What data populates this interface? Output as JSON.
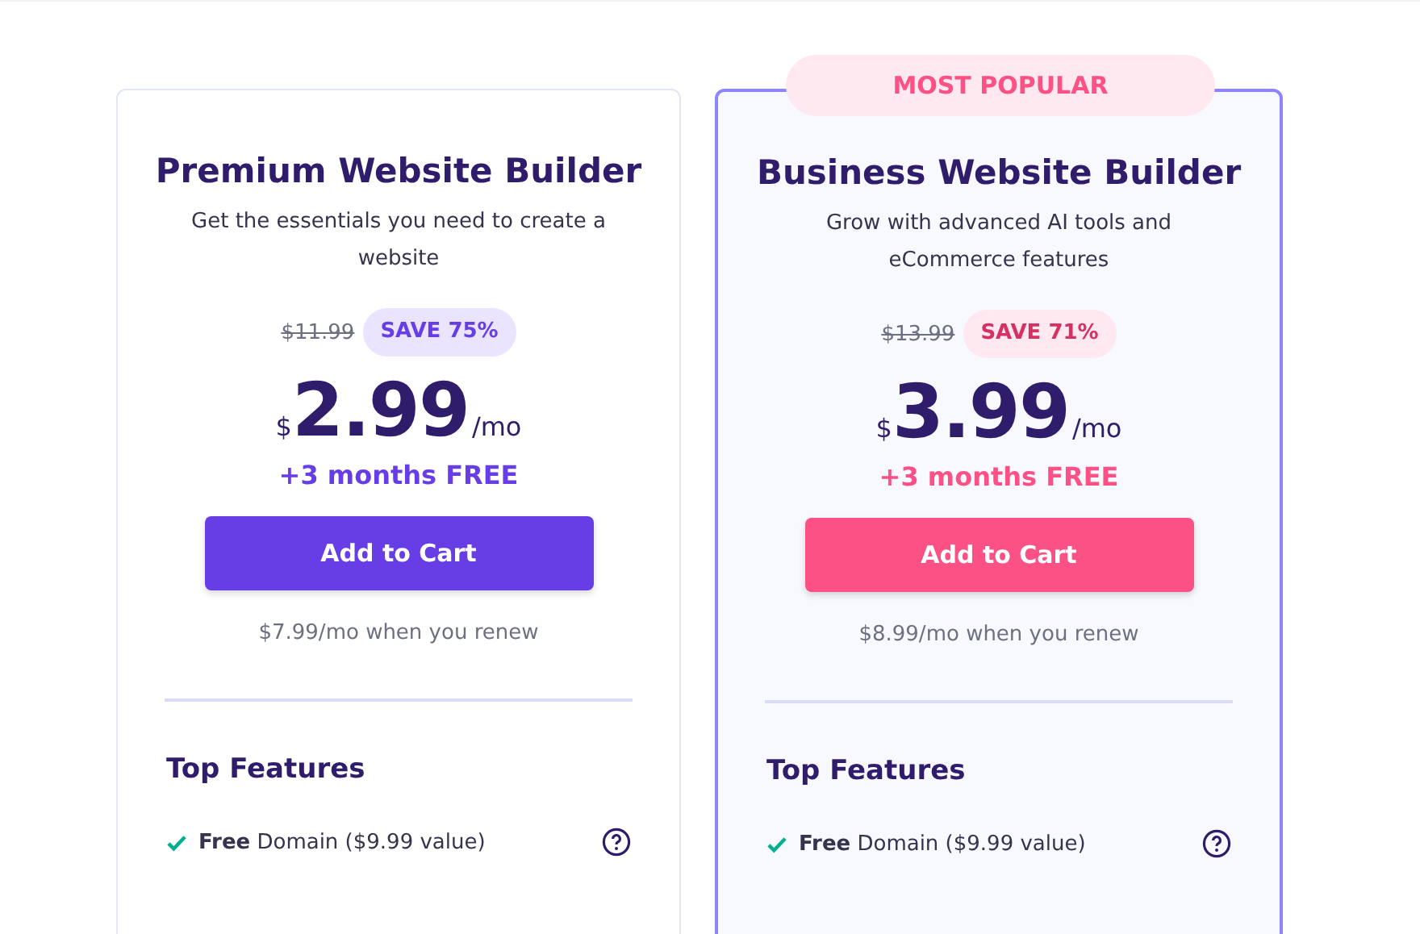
{
  "plans": [
    {
      "featured": false,
      "title": "Premium Website Builder",
      "description": "Get the essentials you need to create a website",
      "old_price": "$11.99",
      "save": "SAVE 75%",
      "currency": "$",
      "price": "2.99",
      "period": "/mo",
      "bonus": "+3 months FREE",
      "button": "Add to Cart",
      "renew": "$7.99/mo when you renew",
      "features_title": "Top Features",
      "features": [
        "**Free** Domain ($9.99 value)"
      ]
    },
    {
      "featured": true,
      "badge": "MOST POPULAR",
      "title": "Business Website Builder",
      "description": "Grow with advanced AI tools and eCommerce features",
      "old_price": "$13.99",
      "save": "SAVE 71%",
      "currency": "$",
      "price": "3.99",
      "period": "/mo",
      "bonus": "+3 months FREE",
      "button": "Add to Cart",
      "renew": "$8.99/mo when you renew",
      "features_title": "Top Features",
      "features": [
        "**Free** Domain ($9.99 value)"
      ]
    }
  ]
}
